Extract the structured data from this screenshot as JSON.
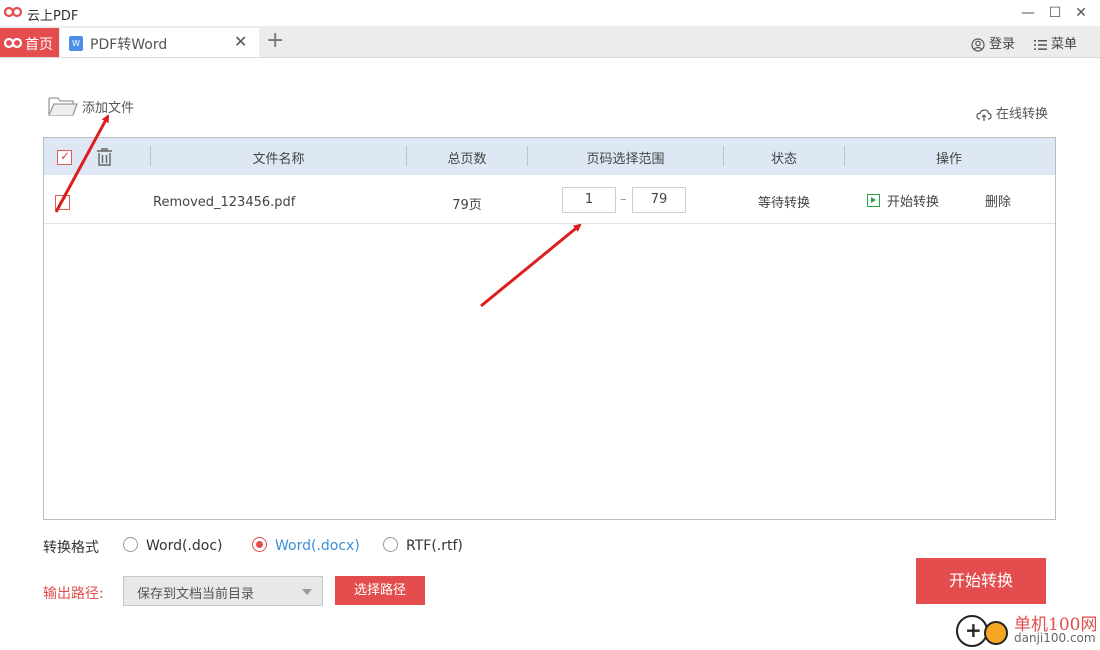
{
  "app": {
    "title": "云上PDF"
  },
  "window_controls": {
    "minimize": "—",
    "maximize": "☐",
    "close": "✕"
  },
  "tabs": [
    {
      "label": "首页",
      "active": false
    },
    {
      "label": "PDF转Word",
      "active": true
    }
  ],
  "tab_add": "+",
  "tab_close": "✕",
  "header_right": {
    "login": "登录",
    "menu": "菜单"
  },
  "toolbar": {
    "add_file": "添加文件",
    "online_convert": "在线转换"
  },
  "table": {
    "columns": [
      "文件名称",
      "总页数",
      "页码选择范围",
      "状态",
      "操作"
    ],
    "rows": [
      {
        "filename": "Removed_123456.pdf",
        "pages": "79页",
        "range_start": "1",
        "range_sep": "–",
        "range_end": "79",
        "status": "等待转换",
        "action_start": "开始转换",
        "action_delete": "删除",
        "checked": true
      }
    ]
  },
  "format": {
    "label": "转换格式",
    "options": [
      {
        "label": "Word(.doc)",
        "selected": false
      },
      {
        "label": "Word(.docx)",
        "selected": true
      },
      {
        "label": "RTF(.rtf)",
        "selected": false
      }
    ]
  },
  "output": {
    "label": "输出路径:",
    "selected": "保存到文档当前目录",
    "choose_button": "选择路径"
  },
  "start_button": "开始转换",
  "watermark": {
    "line1": "单机100网",
    "line2": "danji100.com"
  },
  "colors": {
    "accent": "#e34d4d",
    "header_bg": "#dde8f4",
    "link_blue": "#3b8fd8",
    "play_green": "#27a046",
    "arrow_red": "#dd1e1e"
  }
}
